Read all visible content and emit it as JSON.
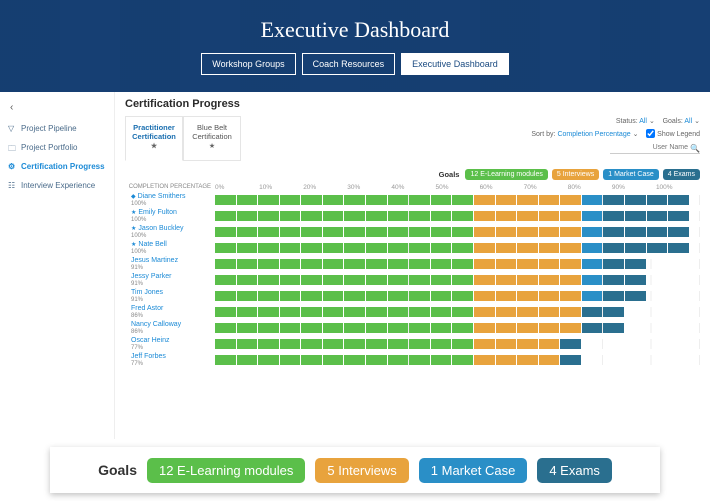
{
  "hero": {
    "title": "Executive Dashboard",
    "tabs": [
      "Workshop Groups",
      "Coach Resources",
      "Executive Dashboard"
    ],
    "active_tab": 2
  },
  "sidebar": {
    "items": [
      {
        "label": "Project Pipeline",
        "icon": "funnel-icon"
      },
      {
        "label": "Project Portfolio",
        "icon": "folder-icon"
      },
      {
        "label": "Certification Progress",
        "icon": "gear-icon"
      },
      {
        "label": "Interview Experience",
        "icon": "bars-icon"
      }
    ],
    "active": 2
  },
  "page": {
    "title": "Certification Progress",
    "cert_tabs": [
      {
        "label": "Practitioner Certification",
        "starred": true
      },
      {
        "label": "Blue Belt Certification",
        "starred": true
      }
    ],
    "active_cert_tab": 0,
    "filters": {
      "status_label": "Status:",
      "status_value": "All",
      "goals_label": "Goals:",
      "goals_value": "All",
      "sort_label": "Sort by:",
      "sort_value": "Completion Percentage",
      "show_legend_label": "Show Legend",
      "show_legend_checked": true,
      "search_placeholder": "User Name"
    },
    "legend": {
      "title": "Goals",
      "items": [
        {
          "label": "12 E-Learning modules",
          "color": "#5bbf4a"
        },
        {
          "label": "5 Interviews",
          "color": "#e8a33d"
        },
        {
          "label": "1 Market Case",
          "color": "#2a8fc7"
        },
        {
          "label": "4 Exams",
          "color": "#2a6f8f"
        }
      ]
    },
    "axis_label": "Completion Percentage",
    "ticks": [
      "0%",
      "10%",
      "20%",
      "30%",
      "40%",
      "50%",
      "60%",
      "70%",
      "80%",
      "90%",
      "100%"
    ]
  },
  "chart_data": {
    "type": "bar",
    "title": "Certification Progress — Completion Percentage",
    "xlabel": "Completion Percentage",
    "ylabel": "",
    "xlim": [
      0,
      100
    ],
    "goal_totals": {
      "elearning": 12,
      "interviews": 5,
      "market_case": 1,
      "exams": 4
    },
    "segments": [
      "elearning",
      "interviews",
      "market_case",
      "exams"
    ],
    "segment_colors": {
      "elearning": "#5bbf4a",
      "interviews": "#e8a33d",
      "market_case": "#2a8fc7",
      "exams": "#2a6f8f"
    },
    "rows": [
      {
        "name": "Diane Smithers",
        "marker": "diamond",
        "pct": 100,
        "elearning": 12,
        "interviews": 5,
        "market_case": 1,
        "exams": 4
      },
      {
        "name": "Emily Fulton",
        "marker": "star",
        "pct": 100,
        "elearning": 12,
        "interviews": 5,
        "market_case": 1,
        "exams": 4
      },
      {
        "name": "Jason Buckley",
        "marker": "star",
        "pct": 100,
        "elearning": 12,
        "interviews": 5,
        "market_case": 1,
        "exams": 4
      },
      {
        "name": "Nate Bell",
        "marker": "star",
        "pct": 100,
        "elearning": 12,
        "interviews": 5,
        "market_case": 1,
        "exams": 4
      },
      {
        "name": "Jesus Martinez",
        "marker": null,
        "pct": 91,
        "elearning": 12,
        "interviews": 5,
        "market_case": 1,
        "exams": 2
      },
      {
        "name": "Jessy Parker",
        "marker": null,
        "pct": 91,
        "elearning": 12,
        "interviews": 5,
        "market_case": 1,
        "exams": 2
      },
      {
        "name": "Tim Jones",
        "marker": null,
        "pct": 91,
        "elearning": 12,
        "interviews": 5,
        "market_case": 1,
        "exams": 2
      },
      {
        "name": "Fred Astor",
        "marker": null,
        "pct": 86,
        "elearning": 12,
        "interviews": 5,
        "market_case": 0,
        "exams": 2
      },
      {
        "name": "Nancy Calloway",
        "marker": null,
        "pct": 86,
        "elearning": 12,
        "interviews": 5,
        "market_case": 0,
        "exams": 2
      },
      {
        "name": "Oscar Heinz",
        "marker": null,
        "pct": 77,
        "elearning": 12,
        "interviews": 4,
        "market_case": 0,
        "exams": 1
      },
      {
        "name": "Jeff Forbes",
        "marker": null,
        "pct": 77,
        "elearning": 12,
        "interviews": 4,
        "market_case": 0,
        "exams": 1
      }
    ]
  },
  "bottom_strip": {
    "title": "Goals",
    "items": [
      {
        "label": "12 E-Learning modules",
        "color": "#5bbf4a"
      },
      {
        "label": "5 Interviews",
        "color": "#e8a33d"
      },
      {
        "label": "1 Market Case",
        "color": "#2a8fc7"
      },
      {
        "label": "4 Exams",
        "color": "#2a6f8f"
      }
    ]
  }
}
